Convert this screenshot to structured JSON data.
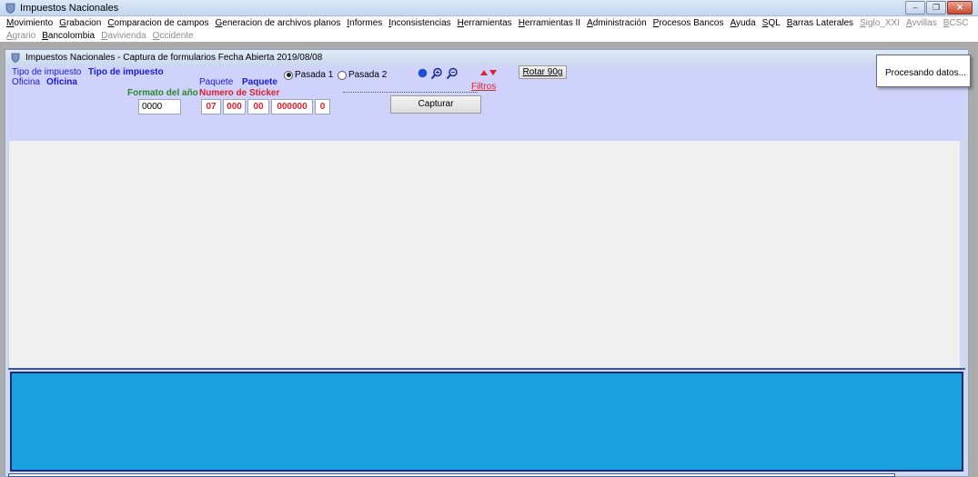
{
  "window": {
    "title": "Impuestos Nacionales",
    "minimize_glyph": "‒",
    "restore_glyph": "❐",
    "close_glyph": "✕"
  },
  "menu": {
    "row1": [
      {
        "label": "Movimiento",
        "enabled": true
      },
      {
        "label": "Grabacion",
        "enabled": true
      },
      {
        "label": "Comparacion de campos",
        "enabled": true
      },
      {
        "label": "Generacion de archivos planos",
        "enabled": true
      },
      {
        "label": "Informes",
        "enabled": true
      },
      {
        "label": "Inconsistencias",
        "enabled": true
      },
      {
        "label": "Herramientas",
        "enabled": true
      },
      {
        "label": "Herramientas II",
        "enabled": true
      },
      {
        "label": "Administración",
        "enabled": true
      },
      {
        "label": "Procesos Bancos",
        "enabled": true
      },
      {
        "label": "Ayuda",
        "enabled": true
      },
      {
        "label": "SQL",
        "enabled": true
      },
      {
        "label": "Barras Laterales",
        "enabled": true
      },
      {
        "label": "Siglo_XXI",
        "enabled": false
      },
      {
        "label": "Avvillas",
        "enabled": false
      },
      {
        "label": "BCSC",
        "enabled": false
      }
    ],
    "row2": [
      {
        "label": "Agrario",
        "enabled": false
      },
      {
        "label": "Bancolombia",
        "enabled": true
      },
      {
        "label": "Davivienda",
        "enabled": false
      },
      {
        "label": "Occidente",
        "enabled": false
      }
    ]
  },
  "child": {
    "title": "Impuestos Nacionales - Captura de formularios Fecha Abierta 2019/08/08"
  },
  "form": {
    "tipo_label": "Tipo de impuesto",
    "tipo_value": "Tipo de impuesto",
    "oficina_label": "Oficina",
    "oficina_value": "Oficina",
    "formato_label": "Formato del año",
    "formato_value": "0000",
    "paquete_label": "Paquete",
    "paquete_value": "Paquete",
    "sticker_label": "Numero de Sticker",
    "sticker_parts": [
      "07",
      "000",
      "00",
      "000000",
      "0"
    ],
    "pasada1": "Pasada 1",
    "pasada2": "Pasada 2",
    "pasada_selected": 1,
    "filtros": "Filtros",
    "rotar": "Rotar 90g",
    "capturar": "Capturar"
  },
  "popup": {
    "text": "Procesando datos..."
  },
  "colors": {
    "label_blue": "#1a1ad6",
    "green": "#2a8a2a",
    "red": "#e0202a",
    "form_bg": "#cfd2fb",
    "panel_blue": "#1aa1e0"
  },
  "icons": [
    "app-icon",
    "blue-circle-icon",
    "zoom-in-icon",
    "zoom-out-icon",
    "arrow-up-icon",
    "arrow-down-icon"
  ]
}
